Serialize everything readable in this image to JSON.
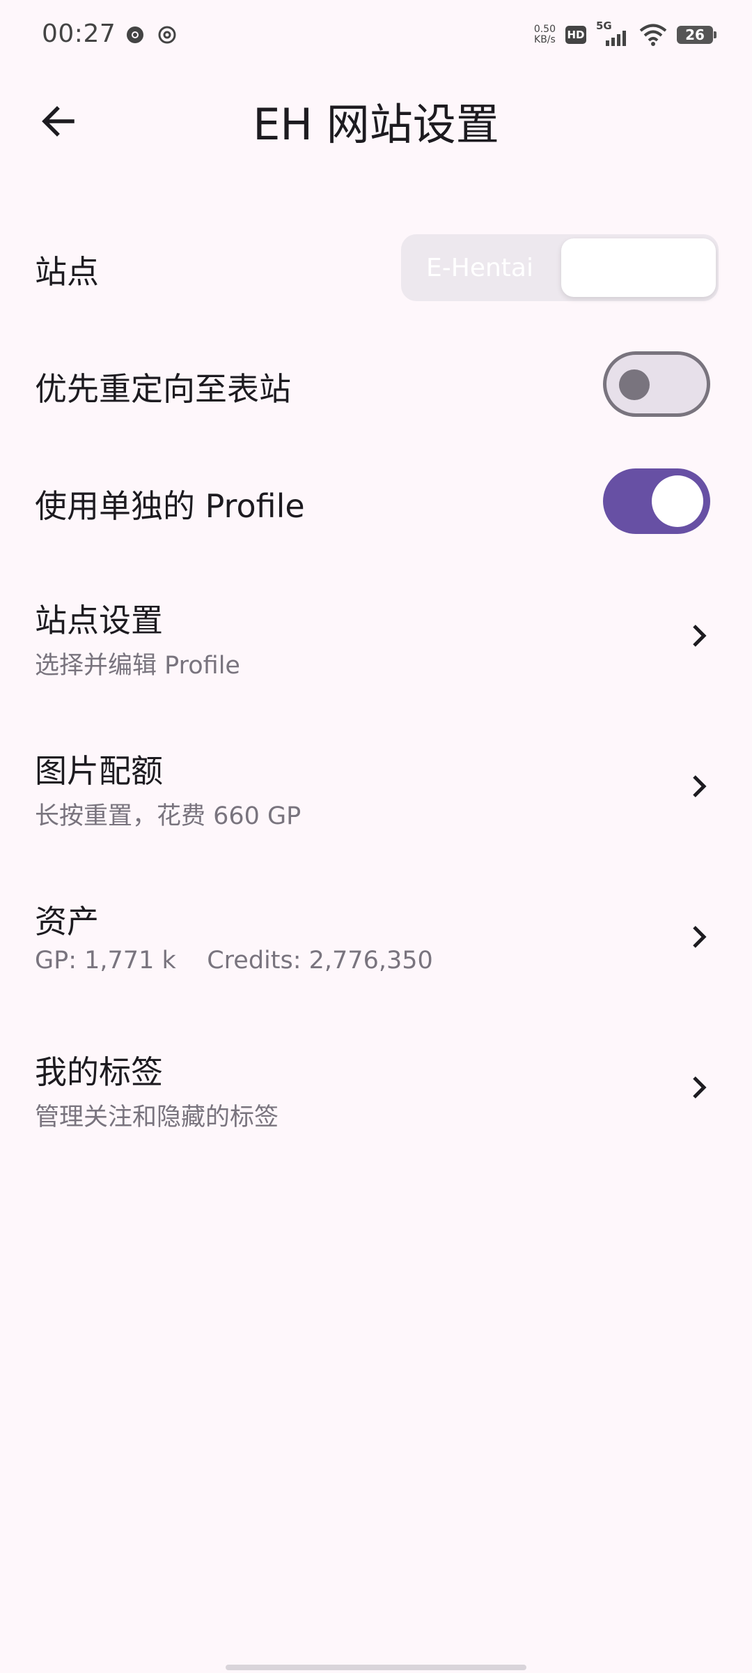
{
  "status_bar": {
    "time": "00:27",
    "net_speed_value": "0.50",
    "net_speed_unit": "KB/s",
    "hd": "HD",
    "network": "5G",
    "battery": "26"
  },
  "app_bar": {
    "title": "EH 网站设置"
  },
  "settings": {
    "site": {
      "label": "站点",
      "options": [
        "E-Hentai",
        ""
      ],
      "selected": 1
    },
    "redirect": {
      "label": "优先重定向至表站",
      "enabled": false
    },
    "profile": {
      "label": "使用单独的 Profile",
      "enabled": true
    },
    "site_settings": {
      "title": "站点设置",
      "subtitle": "选择并编辑 Profile"
    },
    "image_quota": {
      "title": "图片配额",
      "subtitle": "长按重置，花费 660 GP"
    },
    "assets": {
      "title": "资产",
      "subtitle": "GP: 1,771 k    Credits: 2,776,350"
    },
    "my_tags": {
      "title": "我的标签",
      "subtitle": "管理关注和隐藏的标签"
    }
  },
  "colors": {
    "background": "#fef7fb",
    "accent": "#6750a4",
    "text_primary": "#1d1b20",
    "text_secondary": "#79747e"
  }
}
